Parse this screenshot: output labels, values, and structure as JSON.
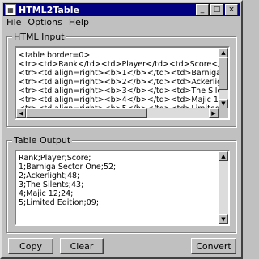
{
  "window": {
    "title": "HTML2Table",
    "icon_name": "app-icon"
  },
  "title_buttons": {
    "minimize": "_",
    "maximize": "□",
    "close": "×"
  },
  "menu": [
    {
      "label": "File"
    },
    {
      "label": "Options"
    },
    {
      "label": "Help"
    }
  ],
  "html_input": {
    "label": "HTML Input",
    "lines": [
      "<table border=0>",
      "<tr><td>Rank</td><td>Player</td><td>Score</td></tr>",
      "<tr><td align=right><b>1</b></td><td>Barniga Sector One</td><t",
      "<tr><td align=right><b>2</b></td><td>Ackerlight</td><td>48</td><",
      "<tr><td align=right><b>3</b></td><td>The Silents</td><td>43</td",
      "<tr><td align=right><b>4</b></td><td>Majic 12</td><td>24</td></",
      "<tr><td align=right><b>5</b></td><td>Limited Edition</td><td>09<"
    ]
  },
  "table_output": {
    "label": "Table Output",
    "lines": [
      "Rank;Player;Score;",
      "1;Barniga Sector One;52;",
      "2;Ackerlight;48;",
      "3;The Silents;43;",
      "4;Majic 12;24;",
      "5;Limited Edition;09;"
    ]
  },
  "buttons": {
    "copy": "Copy",
    "clear": "Clear",
    "convert": "Convert"
  }
}
